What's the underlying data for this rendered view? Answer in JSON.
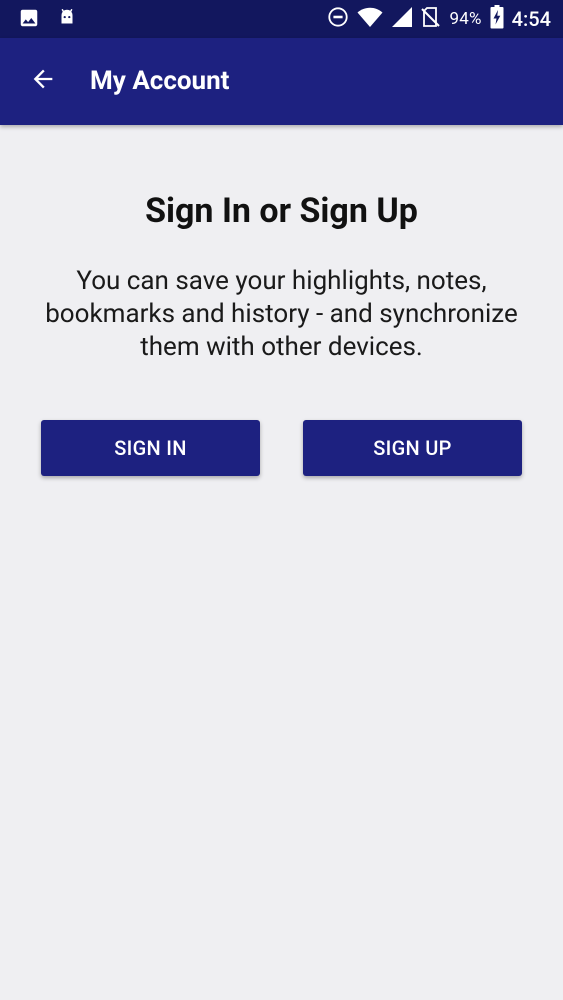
{
  "status_bar": {
    "battery": "94%",
    "time": "4:54",
    "icons": [
      "image-icon",
      "android-icon",
      "do-not-disturb-icon",
      "wifi-icon",
      "cell-signal-icon",
      "no-sim-icon",
      "battery-charging-icon"
    ]
  },
  "app_bar": {
    "title": "My Account",
    "back_icon": "arrow-back-icon",
    "background_color": "#1d2180"
  },
  "main": {
    "heading": "Sign In or Sign Up",
    "description": "You can save your highlights, notes, bookmarks and history - and synchronize them with other devices.",
    "buttons": {
      "sign_in": "SIGN IN",
      "sign_up": "SIGN UP"
    }
  },
  "colors": {
    "primary": "#1d2180",
    "status_bar": "#12175e",
    "background": "#efeff2"
  }
}
